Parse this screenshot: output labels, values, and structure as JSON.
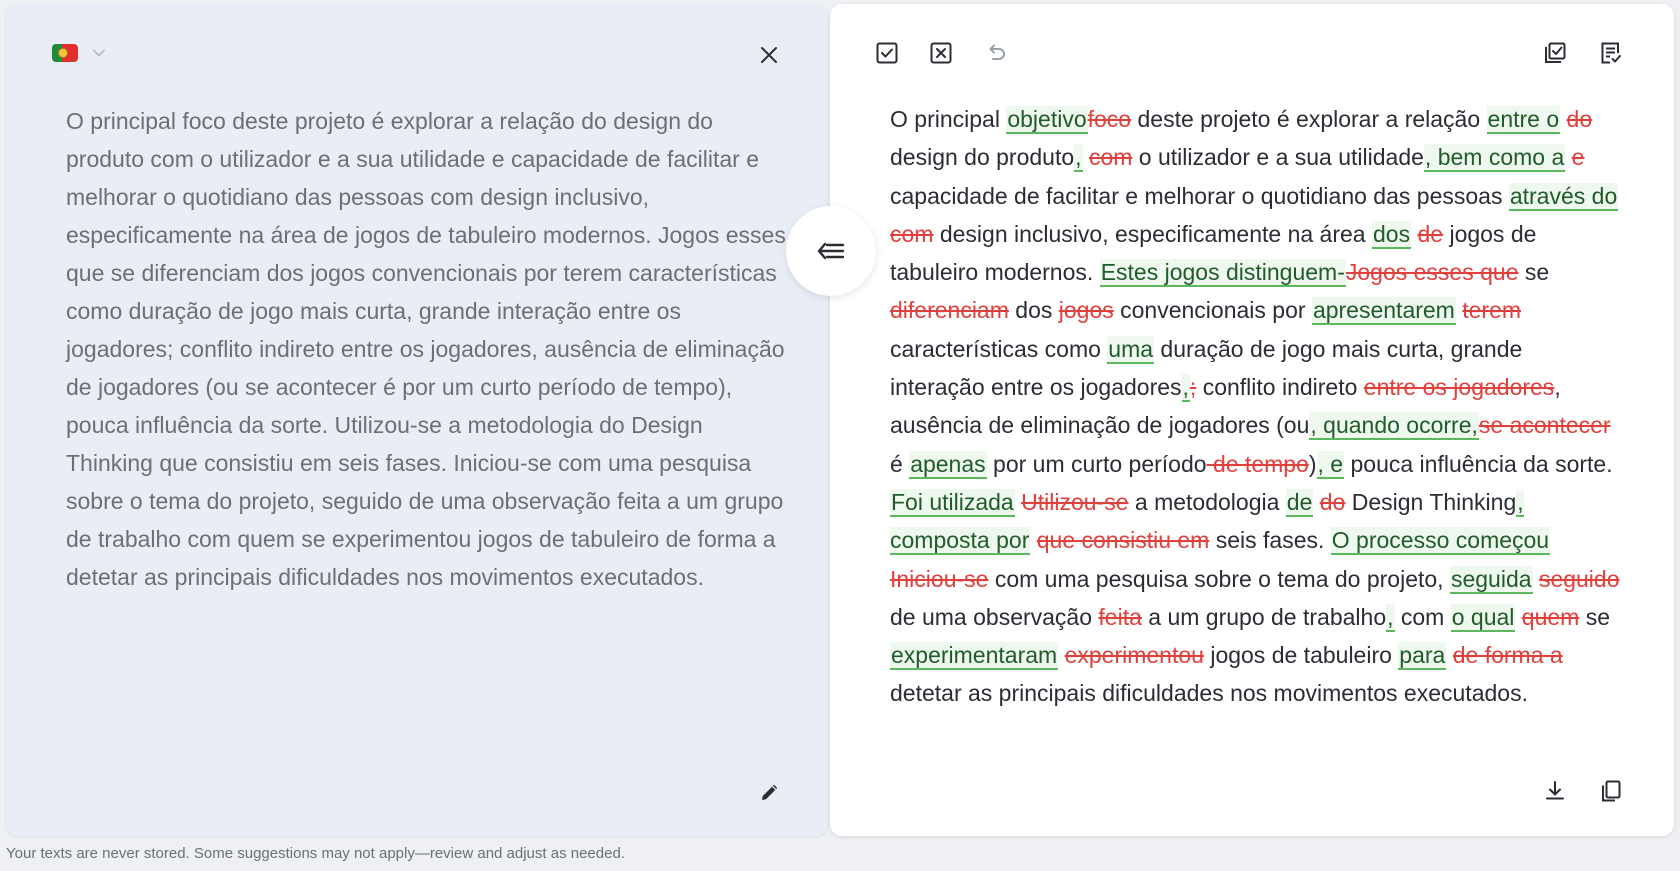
{
  "source": {
    "text": "O principal foco deste projeto é explorar a relação do design do produto com o utilizador e a sua utilidade e capacidade de facilitar e melhorar o quotidiano das pessoas com design inclusivo, especificamente na área de jogos de tabuleiro modernos. Jogos esses que se diferenciam dos jogos convencionais por terem características como duração de jogo mais curta, grande interação entre os jogadores; conflito indireto entre os jogadores, ausência de eliminação de jogadores (ou se acontecer é por um curto período de tempo), pouca influência da sorte. Utilizou-se a metodologia do Design Thinking que consistiu em seis fases. Iniciou-se com uma pesquisa sobre o tema do projeto, seguido de uma observação feita a um grupo de trabalho com quem se experimentou jogos de tabuleiro de forma a detetar as principais dificuldades nos movimentos executados."
  },
  "footer": "Your texts are never stored. Some suggestions may not apply—review and adjust as needed.",
  "corrected_segments": [
    {
      "t": "n",
      "s": "O principal "
    },
    {
      "t": "i",
      "s": "objetivo"
    },
    {
      "t": "d",
      "s": "foco"
    },
    {
      "t": "n",
      "s": " deste projeto é explorar a relação "
    },
    {
      "t": "i",
      "s": "entre o"
    },
    {
      "t": "n",
      "s": " "
    },
    {
      "t": "d",
      "s": "do"
    },
    {
      "t": "n",
      "s": " design do produto"
    },
    {
      "t": "i",
      "s": ","
    },
    {
      "t": "n",
      "s": " "
    },
    {
      "t": "d",
      "s": "com"
    },
    {
      "t": "n",
      "s": " o utilizador e a sua utilidade"
    },
    {
      "t": "i",
      "s": ", bem como a"
    },
    {
      "t": "n",
      "s": " "
    },
    {
      "t": "d",
      "s": "e"
    },
    {
      "t": "n",
      "s": " capacidade de facilitar e melhorar o quotidiano das pessoas "
    },
    {
      "t": "i",
      "s": "através do"
    },
    {
      "t": "n",
      "s": " "
    },
    {
      "t": "d",
      "s": "com"
    },
    {
      "t": "n",
      "s": " design inclusivo, especificamente na área "
    },
    {
      "t": "i",
      "s": "dos"
    },
    {
      "t": "n",
      "s": " "
    },
    {
      "t": "d",
      "s": "de"
    },
    {
      "t": "n",
      "s": " jogos de tabuleiro modernos. "
    },
    {
      "t": "i",
      "s": "Estes jogos distinguem-"
    },
    {
      "t": "d",
      "s": "Jogos esses que"
    },
    {
      "t": "n",
      "s": " se "
    },
    {
      "t": "d",
      "s": "diferenciam"
    },
    {
      "t": "n",
      "s": " dos "
    },
    {
      "t": "d",
      "s": "jogos"
    },
    {
      "t": "n",
      "s": " convencionais por "
    },
    {
      "t": "i",
      "s": "apresentarem"
    },
    {
      "t": "n",
      "s": " "
    },
    {
      "t": "d",
      "s": "terem"
    },
    {
      "t": "n",
      "s": " características como "
    },
    {
      "t": "i",
      "s": "uma"
    },
    {
      "t": "n",
      "s": " duração de jogo mais curta, grande interação entre os jogadores"
    },
    {
      "t": "i",
      "s": ","
    },
    {
      "t": "d",
      "s": ";"
    },
    {
      "t": "n",
      "s": " conflito indireto "
    },
    {
      "t": "d",
      "s": "entre os jogadores"
    },
    {
      "t": "n",
      "s": ", ausência de eliminação de jogadores (ou"
    },
    {
      "t": "i",
      "s": ", quando ocorre,"
    },
    {
      "t": "d",
      "s": "se acontecer"
    },
    {
      "t": "n",
      "s": " é "
    },
    {
      "t": "i",
      "s": "apenas"
    },
    {
      "t": "n",
      "s": " por um curto período"
    },
    {
      "t": "d",
      "s": " de tempo"
    },
    {
      "t": "n",
      "s": ")"
    },
    {
      "t": "i",
      "s": ", e"
    },
    {
      "t": "n",
      "s": " pouca influência da sorte. "
    },
    {
      "t": "i",
      "s": "Foi utilizada"
    },
    {
      "t": "n",
      "s": " "
    },
    {
      "t": "d",
      "s": "Utilizou-se"
    },
    {
      "t": "n",
      "s": " a metodologia "
    },
    {
      "t": "i",
      "s": "de"
    },
    {
      "t": "n",
      "s": " "
    },
    {
      "t": "d",
      "s": "do"
    },
    {
      "t": "n",
      "s": " Design Thinking"
    },
    {
      "t": "i",
      "s": ", composta por"
    },
    {
      "t": "n",
      "s": " "
    },
    {
      "t": "d",
      "s": "que consistiu em"
    },
    {
      "t": "n",
      "s": " seis fases. "
    },
    {
      "t": "i",
      "s": "O processo começou"
    },
    {
      "t": "n",
      "s": " "
    },
    {
      "t": "d",
      "s": "Iniciou-se"
    },
    {
      "t": "n",
      "s": " com uma pesquisa sobre o tema do projeto, "
    },
    {
      "t": "i",
      "s": "seguida"
    },
    {
      "t": "n",
      "s": " "
    },
    {
      "t": "d",
      "s": "seguido"
    },
    {
      "t": "n",
      "s": " de uma observação "
    },
    {
      "t": "d",
      "s": "feita"
    },
    {
      "t": "n",
      "s": " a um grupo de trabalho"
    },
    {
      "t": "i",
      "s": ","
    },
    {
      "t": "n",
      "s": " com "
    },
    {
      "t": "i",
      "s": "o qual"
    },
    {
      "t": "n",
      "s": " "
    },
    {
      "t": "d",
      "s": "quem"
    },
    {
      "t": "n",
      "s": " se "
    },
    {
      "t": "i",
      "s": "experimentaram"
    },
    {
      "t": "n",
      "s": " "
    },
    {
      "t": "d",
      "s": "experimentou"
    },
    {
      "t": "n",
      "s": " jogos de tabuleiro "
    },
    {
      "t": "i",
      "s": "para"
    },
    {
      "t": "n",
      "s": " "
    },
    {
      "t": "d",
      "s": "de forma a"
    },
    {
      "t": "n",
      "s": " detetar as principais dificuldades nos movimentos executados."
    }
  ],
  "icons": {
    "language_flag": "portugal-flag-icon",
    "language_dropdown": "chevron-down-icon",
    "close": "close-icon",
    "edit": "pencil-icon",
    "swap": "collapse-left-icon",
    "accept_all": "checkbox-check-icon",
    "reject_all": "checkbox-x-icon",
    "undo": "undo-icon",
    "review": "check-list-icon",
    "notes": "document-check-icon",
    "download": "download-icon",
    "copy": "copy-icon"
  },
  "colors": {
    "insert": "#5cb85c",
    "delete": "#e0413d",
    "left_panel_bg": "#e9edf6"
  }
}
